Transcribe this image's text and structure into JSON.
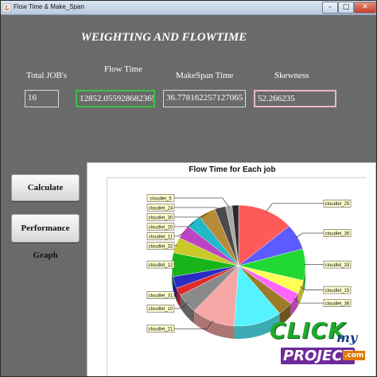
{
  "window": {
    "title": "Flow Time & Make_Span",
    "minimize_glyph": "–",
    "maximize_glyph": "□",
    "close_glyph": "✕"
  },
  "heading": "WEIGHTING AND FLOWTIME",
  "fields": {
    "total_jobs": {
      "label": "Total JOB's",
      "value": "16"
    },
    "flow_time": {
      "label": "Flow Time",
      "value": "12852.055928682365"
    },
    "makespan": {
      "label": "MakeSpan Time",
      "value": "36.778162257127065"
    },
    "skewness": {
      "label": "Skewness",
      "value": "52.266235"
    }
  },
  "buttons": {
    "calculate": "Calculate",
    "performance_graph": "Performance Graph"
  },
  "chart_data": {
    "type": "pie",
    "title": "Flow Time for Each job",
    "style": "3d-pie",
    "slices": [
      {
        "label": "cloudlet_25",
        "value": 13.0,
        "color": "#ff5a5a"
      },
      {
        "label": "cloudlet_35",
        "value": 6.5,
        "color": "#5b5bff"
      },
      {
        "label": "cloudlet_33",
        "value": 8.0,
        "color": "#22d833"
      },
      {
        "label": "cloudlet_15",
        "value": 3.5,
        "color": "#ffff55"
      },
      {
        "label": "cloudlet_36",
        "value": 3.0,
        "color": "#ff66ff"
      },
      {
        "label": "",
        "value": 3.5,
        "color": "#9b7a28"
      },
      {
        "label": "",
        "value": 11.0,
        "color": "#55f3ff"
      },
      {
        "label": "cloudlet_21",
        "value": 10.0,
        "color": "#f7a6a6"
      },
      {
        "label": "cloudlet_10",
        "value": 5.0,
        "color": "#8a8a8a"
      },
      {
        "label": "cloudlet_31",
        "value": 2.0,
        "color": "#e02a2a"
      },
      {
        "label": "",
        "value": 3.0,
        "color": "#2c2cc4"
      },
      {
        "label": "cloudlet_12",
        "value": 6.0,
        "color": "#17b51a"
      },
      {
        "label": "cloudlet_32",
        "value": 4.0,
        "color": "#c8c828"
      },
      {
        "label": "cloudlet_11",
        "value": 3.5,
        "color": "#bb44c4"
      },
      {
        "label": "cloudlet_20",
        "value": 3.5,
        "color": "#22b8c8"
      },
      {
        "label": "cloudlet_30",
        "value": 4.0,
        "color": "#b78a3a"
      },
      {
        "label": "cloudlet_24",
        "value": 2.5,
        "color": "#4a4a4a"
      },
      {
        "label": "cloudlet_5",
        "value": 1.5,
        "color": "#a7a7a7"
      },
      {
        "label": "",
        "value": 1.5,
        "color": "#2a2a2a"
      }
    ]
  },
  "watermark": {
    "click": "CLICK",
    "my": "my",
    "project": "PROJECT",
    "com": ".com"
  },
  "colors": {
    "panel_background": "#6a6a6a",
    "flow_time_border": "#3bbf48",
    "skewness_border": "#e6b9c6"
  }
}
